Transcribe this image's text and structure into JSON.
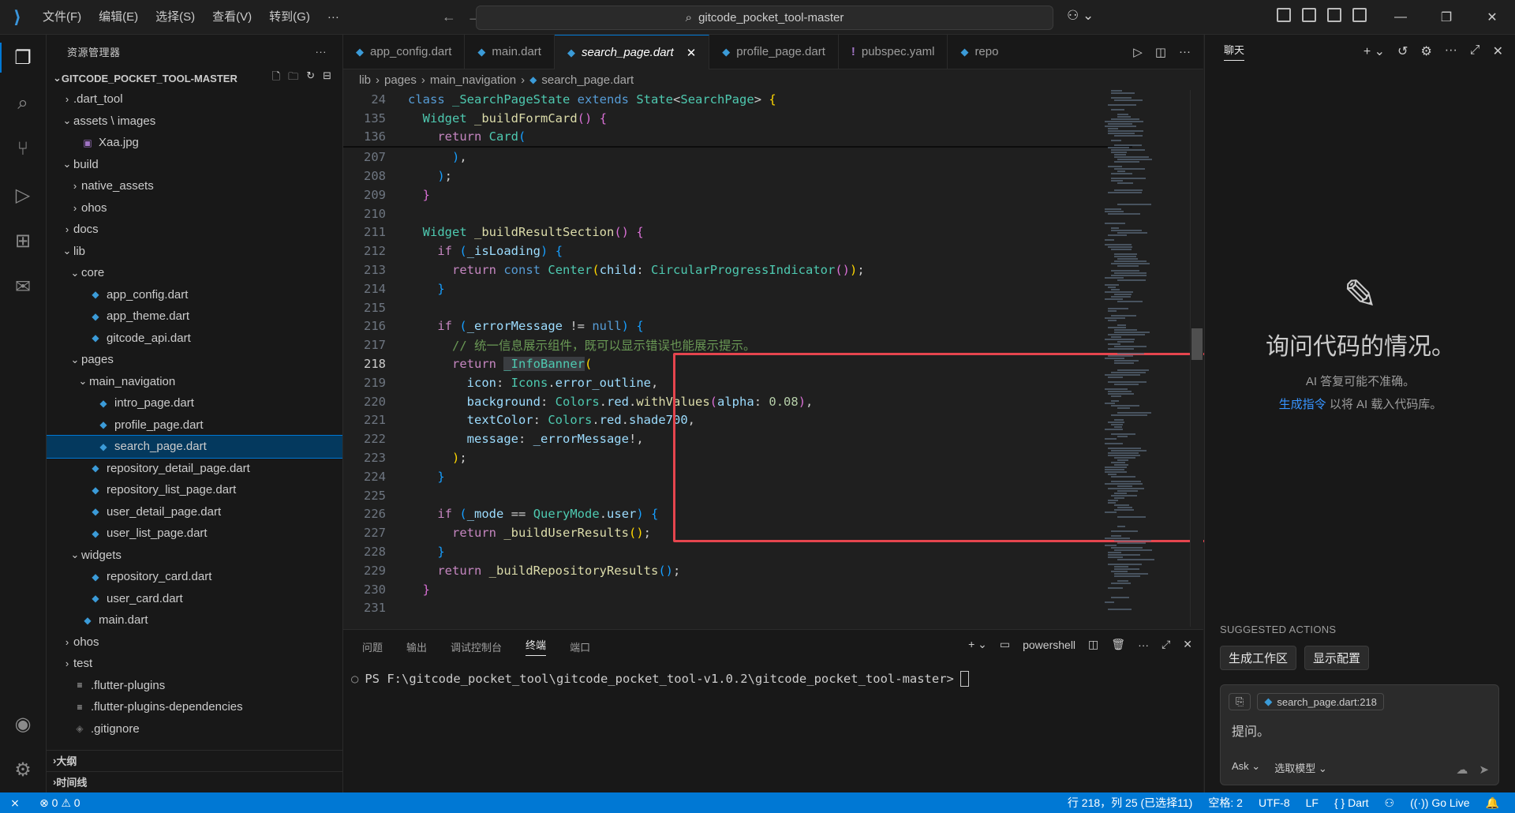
{
  "titlebar": {
    "menu": [
      "文件(F)",
      "编辑(E)",
      "选择(S)",
      "查看(V)",
      "转到(G)",
      "···"
    ],
    "search_text": "gitcode_pocket_tool-master"
  },
  "sidebar": {
    "title": "资源管理器",
    "project": "GITCODE_POCKET_TOOL-MASTER",
    "tree": [
      {
        "label": ".dart_tool",
        "indent": 1,
        "kind": "folder-closed"
      },
      {
        "label": "assets \\ images",
        "indent": 1,
        "kind": "folder-open"
      },
      {
        "label": "Xaa.jpg",
        "indent": 2,
        "kind": "image"
      },
      {
        "label": "build",
        "indent": 1,
        "kind": "folder-open"
      },
      {
        "label": "native_assets",
        "indent": 2,
        "kind": "folder-closed"
      },
      {
        "label": "ohos",
        "indent": 2,
        "kind": "folder-closed"
      },
      {
        "label": "docs",
        "indent": 1,
        "kind": "folder-closed"
      },
      {
        "label": "lib",
        "indent": 1,
        "kind": "folder-open"
      },
      {
        "label": "core",
        "indent": 2,
        "kind": "folder-open"
      },
      {
        "label": "app_config.dart",
        "indent": 3,
        "kind": "dart"
      },
      {
        "label": "app_theme.dart",
        "indent": 3,
        "kind": "dart"
      },
      {
        "label": "gitcode_api.dart",
        "indent": 3,
        "kind": "dart"
      },
      {
        "label": "pages",
        "indent": 2,
        "kind": "folder-open"
      },
      {
        "label": "main_navigation",
        "indent": 3,
        "kind": "folder-open"
      },
      {
        "label": "intro_page.dart",
        "indent": 4,
        "kind": "dart"
      },
      {
        "label": "profile_page.dart",
        "indent": 4,
        "kind": "dart"
      },
      {
        "label": "search_page.dart",
        "indent": 4,
        "kind": "dart",
        "selected": true
      },
      {
        "label": "repository_detail_page.dart",
        "indent": 3,
        "kind": "dart"
      },
      {
        "label": "repository_list_page.dart",
        "indent": 3,
        "kind": "dart"
      },
      {
        "label": "user_detail_page.dart",
        "indent": 3,
        "kind": "dart"
      },
      {
        "label": "user_list_page.dart",
        "indent": 3,
        "kind": "dart"
      },
      {
        "label": "widgets",
        "indent": 2,
        "kind": "folder-open"
      },
      {
        "label": "repository_card.dart",
        "indent": 3,
        "kind": "dart"
      },
      {
        "label": "user_card.dart",
        "indent": 3,
        "kind": "dart"
      },
      {
        "label": "main.dart",
        "indent": 2,
        "kind": "dart"
      },
      {
        "label": "ohos",
        "indent": 1,
        "kind": "folder-closed"
      },
      {
        "label": "test",
        "indent": 1,
        "kind": "folder-closed"
      },
      {
        "label": ".flutter-plugins",
        "indent": 1,
        "kind": "text"
      },
      {
        "label": ".flutter-plugins-dependencies",
        "indent": 1,
        "kind": "text"
      },
      {
        "label": ".gitignore",
        "indent": 1,
        "kind": "git"
      }
    ],
    "outline_label": "大纲",
    "timeline_label": "时间线"
  },
  "tabs": [
    {
      "label": "app_config.dart",
      "icon": "dart",
      "active": false
    },
    {
      "label": "main.dart",
      "icon": "dart",
      "active": false
    },
    {
      "label": "search_page.dart",
      "icon": "dart",
      "active": true
    },
    {
      "label": "profile_page.dart",
      "icon": "dart",
      "active": false
    },
    {
      "label": "pubspec.yaml",
      "icon": "yaml",
      "active": false
    },
    {
      "label": "repo",
      "icon": "dart",
      "active": false
    }
  ],
  "breadcrumb": [
    "lib",
    "pages",
    "main_navigation",
    "search_page.dart"
  ],
  "code": {
    "sticky": [
      {
        "ln": "24",
        "html": "<span class=\"kw\">class</span> <span class=\"ty\">_SearchPageState</span> <span class=\"kw\">extends</span> <span class=\"ty\">State</span>&lt;<span class=\"ty\">SearchPage</span>&gt; <span class=\"br1\">{</span>"
      },
      {
        "ln": "135",
        "html": "  <span class=\"ty\">Widget</span> <span class=\"fn\">_buildFormCard</span><span class=\"br2\">()</span> <span class=\"br2\">{</span>"
      },
      {
        "ln": "136",
        "html": "    <span class=\"kw2\">return</span> <span class=\"ty\">Card</span><span class=\"br3\">(</span>"
      }
    ],
    "lines": [
      {
        "ln": "207",
        "html": "      <span class=\"br3\">)</span>,"
      },
      {
        "ln": "208",
        "html": "    <span class=\"br3\">)</span>;"
      },
      {
        "ln": "209",
        "html": "  <span class=\"br2\">}</span>"
      },
      {
        "ln": "210",
        "html": ""
      },
      {
        "ln": "211",
        "html": "  <span class=\"ty\">Widget</span> <span class=\"fn\">_buildResultSection</span><span class=\"br2\">()</span> <span class=\"br2\">{</span>"
      },
      {
        "ln": "212",
        "html": "    <span class=\"kw2\">if</span> <span class=\"br3\">(</span><span class=\"var\">_isLoading</span><span class=\"br3\">)</span> <span class=\"br3\">{</span>"
      },
      {
        "ln": "213",
        "html": "      <span class=\"kw2\">return</span> <span class=\"kw\">const</span> <span class=\"ty\">Center</span><span class=\"br1\">(</span><span class=\"var\">child</span>: <span class=\"ty\">CircularProgressIndicator</span><span class=\"br2\">()</span><span class=\"br1\">)</span>;"
      },
      {
        "ln": "214",
        "html": "    <span class=\"br3\">}</span>"
      },
      {
        "ln": "215",
        "html": ""
      },
      {
        "ln": "216",
        "html": "    <span class=\"kw2\">if</span> <span class=\"br3\">(</span><span class=\"var\">_errorMessage</span> != <span class=\"kw\">null</span><span class=\"br3\">)</span> <span class=\"br3\">{</span>"
      },
      {
        "ln": "217",
        "html": "      <span class=\"cm\">// 统一信息展示组件，既可以显示错误也能展示提示。</span>"
      },
      {
        "ln": "218",
        "html": "      <span class=\"kw2\">return</span> <span class=\"hl\"><span class=\"ty\">_InfoBanner</span></span><span class=\"br1\">(</span>",
        "cur": true
      },
      {
        "ln": "219",
        "html": "        <span class=\"var\">icon</span>: <span class=\"ty\">Icons</span>.<span class=\"var\">error_outline</span>,"
      },
      {
        "ln": "220",
        "html": "        <span class=\"var\">background</span>: <span class=\"ty\">Colors</span>.<span class=\"var\">red</span>.<span class=\"fn\">withValues</span><span class=\"br2\">(</span><span class=\"var\">alpha</span>: <span class=\"num\">0.08</span><span class=\"br2\">)</span>,"
      },
      {
        "ln": "221",
        "html": "        <span class=\"var\">textColor</span>: <span class=\"ty\">Colors</span>.<span class=\"var\">red</span>.<span class=\"var\">shade700</span>,"
      },
      {
        "ln": "222",
        "html": "        <span class=\"var\">message</span>: <span class=\"var\">_errorMessage</span>!,"
      },
      {
        "ln": "223",
        "html": "      <span class=\"br1\">)</span>;"
      },
      {
        "ln": "224",
        "html": "    <span class=\"br3\">}</span>"
      },
      {
        "ln": "225",
        "html": ""
      },
      {
        "ln": "226",
        "html": "    <span class=\"kw2\">if</span> <span class=\"br3\">(</span><span class=\"var\">_mode</span> == <span class=\"ty\">QueryMode</span>.<span class=\"var\">user</span><span class=\"br3\">)</span> <span class=\"br3\">{</span>"
      },
      {
        "ln": "227",
        "html": "      <span class=\"kw2\">return</span> <span class=\"fn\">_buildUserResults</span><span class=\"br1\">()</span>;"
      },
      {
        "ln": "228",
        "html": "    <span class=\"br3\">}</span>"
      },
      {
        "ln": "229",
        "html": "    <span class=\"kw2\">return</span> <span class=\"fn\">_buildRepositoryResults</span><span class=\"br3\">()</span>;"
      },
      {
        "ln": "230",
        "html": "  <span class=\"br2\">}</span>"
      },
      {
        "ln": "231",
        "html": ""
      }
    ]
  },
  "panel": {
    "tabs": [
      "问题",
      "输出",
      "调试控制台",
      "终端",
      "端口"
    ],
    "active_tab": "终端",
    "shell_label": "powershell",
    "prompt": "PS F:\\gitcode_pocket_tool\\gitcode_pocket_tool-v1.0.2\\gitcode_pocket_tool-master>"
  },
  "chat": {
    "title": "聊天",
    "heading": "询问代码的情况。",
    "disclaimer": "AI 答复可能不准确。",
    "link_text": "生成指令",
    "link_suffix": " 以将 AI 载入代码库。",
    "suggested_label": "SUGGESTED ACTIONS",
    "suggested": [
      "生成工作区",
      "显示配置"
    ],
    "context_chip": "search_page.dart:218",
    "input_placeholder": "提问。",
    "mode": "Ask",
    "model": "选取模型"
  },
  "statusbar": {
    "errors": "0",
    "warnings": "0",
    "position": "行 218，列 25 (已选择11)",
    "spaces": "空格: 2",
    "encoding": "UTF-8",
    "eol": "LF",
    "language": "Dart",
    "golive": "Go Live"
  },
  "colors": {
    "accent": "#0078d4",
    "highlight_box": "#e5454e",
    "dart_icon": "#3b9bd8"
  }
}
